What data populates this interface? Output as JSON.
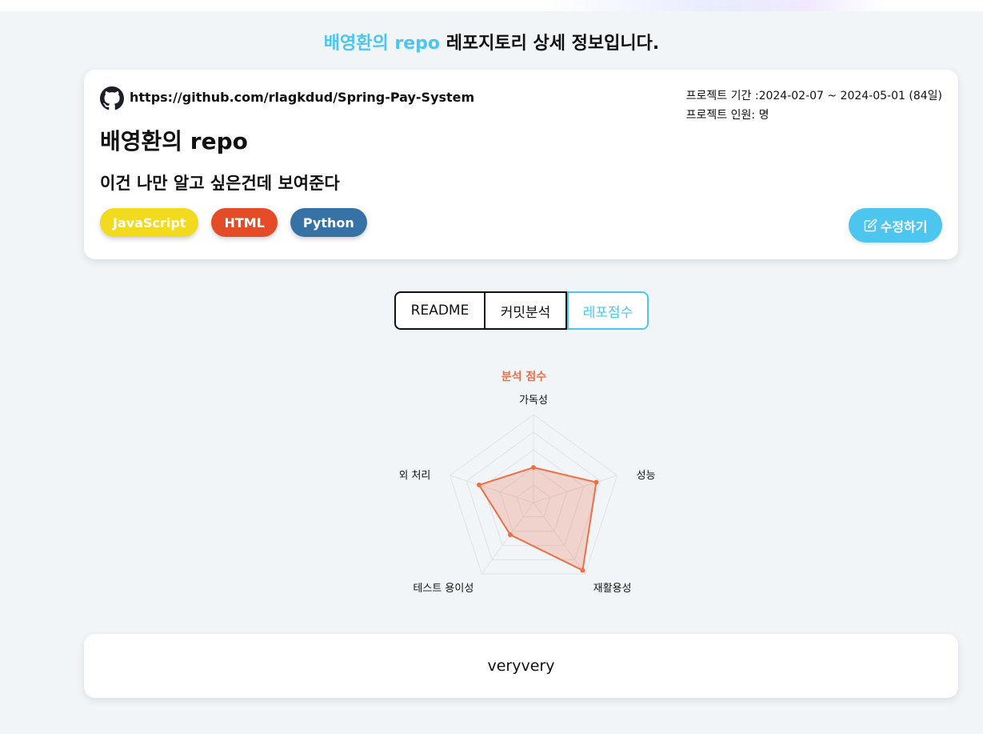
{
  "header": {
    "owner_name": "배영환의 repo",
    "heading_suffix": "레포지토리 상세 정보입니다."
  },
  "repo": {
    "url": "https://github.com/rlagkdud/Spring-Pay-System",
    "title": "배영환의 repo",
    "description": "이건 나만 알고 싶은건데 보여준다",
    "period_text": "프로젝트 기간 :2024-02-07 ~ 2024-05-01 (84일)",
    "members_text": "프로젝트 인원: 명",
    "tags": [
      {
        "label": "JavaScript",
        "color": "#f2da1e"
      },
      {
        "label": "HTML",
        "color": "#e34c26"
      },
      {
        "label": "Python",
        "color": "#3772a6"
      }
    ],
    "edit_label": "수정하기",
    "icons": {
      "github": "github-icon",
      "edit": "edit-icon"
    }
  },
  "tabs": [
    {
      "label": "README",
      "active": false
    },
    {
      "label": "커밋분석",
      "active": false
    },
    {
      "label": "레포점수",
      "active": true
    }
  ],
  "chart_data": {
    "type": "radar",
    "title": "분석 점수",
    "axes": [
      "가독성",
      "성능",
      "재활용성",
      "테스트 용이성",
      "예외 처리"
    ],
    "values": [
      40,
      75,
      95,
      45,
      65
    ],
    "range": [
      0,
      100
    ],
    "color": "#ed7048"
  },
  "bottom": {
    "text": "veryvery"
  }
}
